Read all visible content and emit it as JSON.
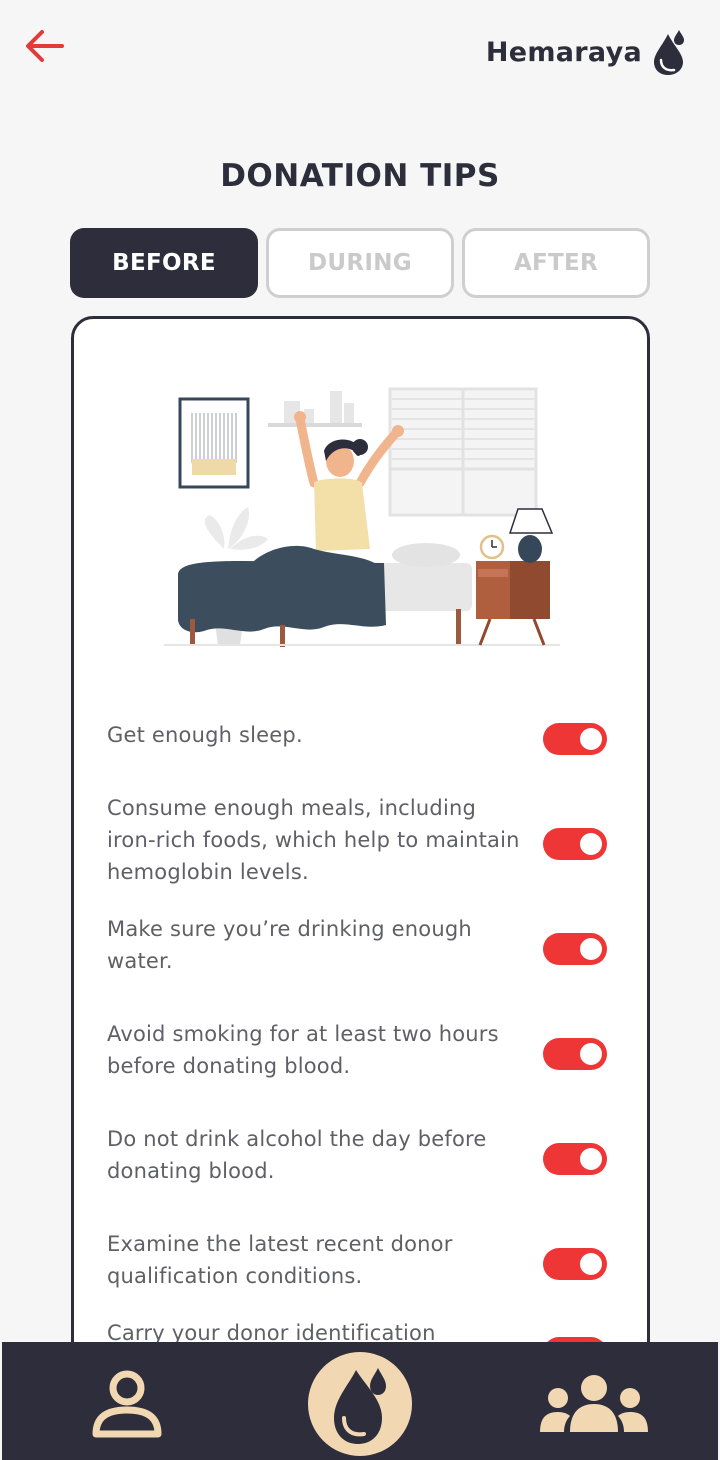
{
  "app": {
    "name": "Hemaraya"
  },
  "page": {
    "title": "DONATION TIPS"
  },
  "tabs": [
    {
      "label": "BEFORE",
      "active": true
    },
    {
      "label": "DURING",
      "active": false
    },
    {
      "label": "AFTER",
      "active": false
    }
  ],
  "tips": [
    {
      "text": "Get enough sleep.",
      "enabled": true
    },
    {
      "text": "Consume enough meals, including iron-rich foods, which help to maintain hemoglobin levels.",
      "enabled": true
    },
    {
      "text": "Make sure you’re drinking enough water.",
      "enabled": true
    },
    {
      "text": "Avoid smoking for at least two hours before donating blood.",
      "enabled": true
    },
    {
      "text": "Do not drink alcohol the day before donating blood.",
      "enabled": true
    },
    {
      "text": "Examine the latest recent donor qualification conditions.",
      "enabled": true
    },
    {
      "text": "Carry your donor identification",
      "enabled": true
    }
  ],
  "nav": [
    {
      "icon": "profile-icon",
      "active": false
    },
    {
      "icon": "blood-drop-icon",
      "active": true
    },
    {
      "icon": "community-icon",
      "active": false
    }
  ],
  "colors": {
    "primary_dark": "#2e2d3b",
    "accent_red": "#ee3637",
    "nav_highlight": "#f2d8b2",
    "background": "#f6f6f6"
  }
}
